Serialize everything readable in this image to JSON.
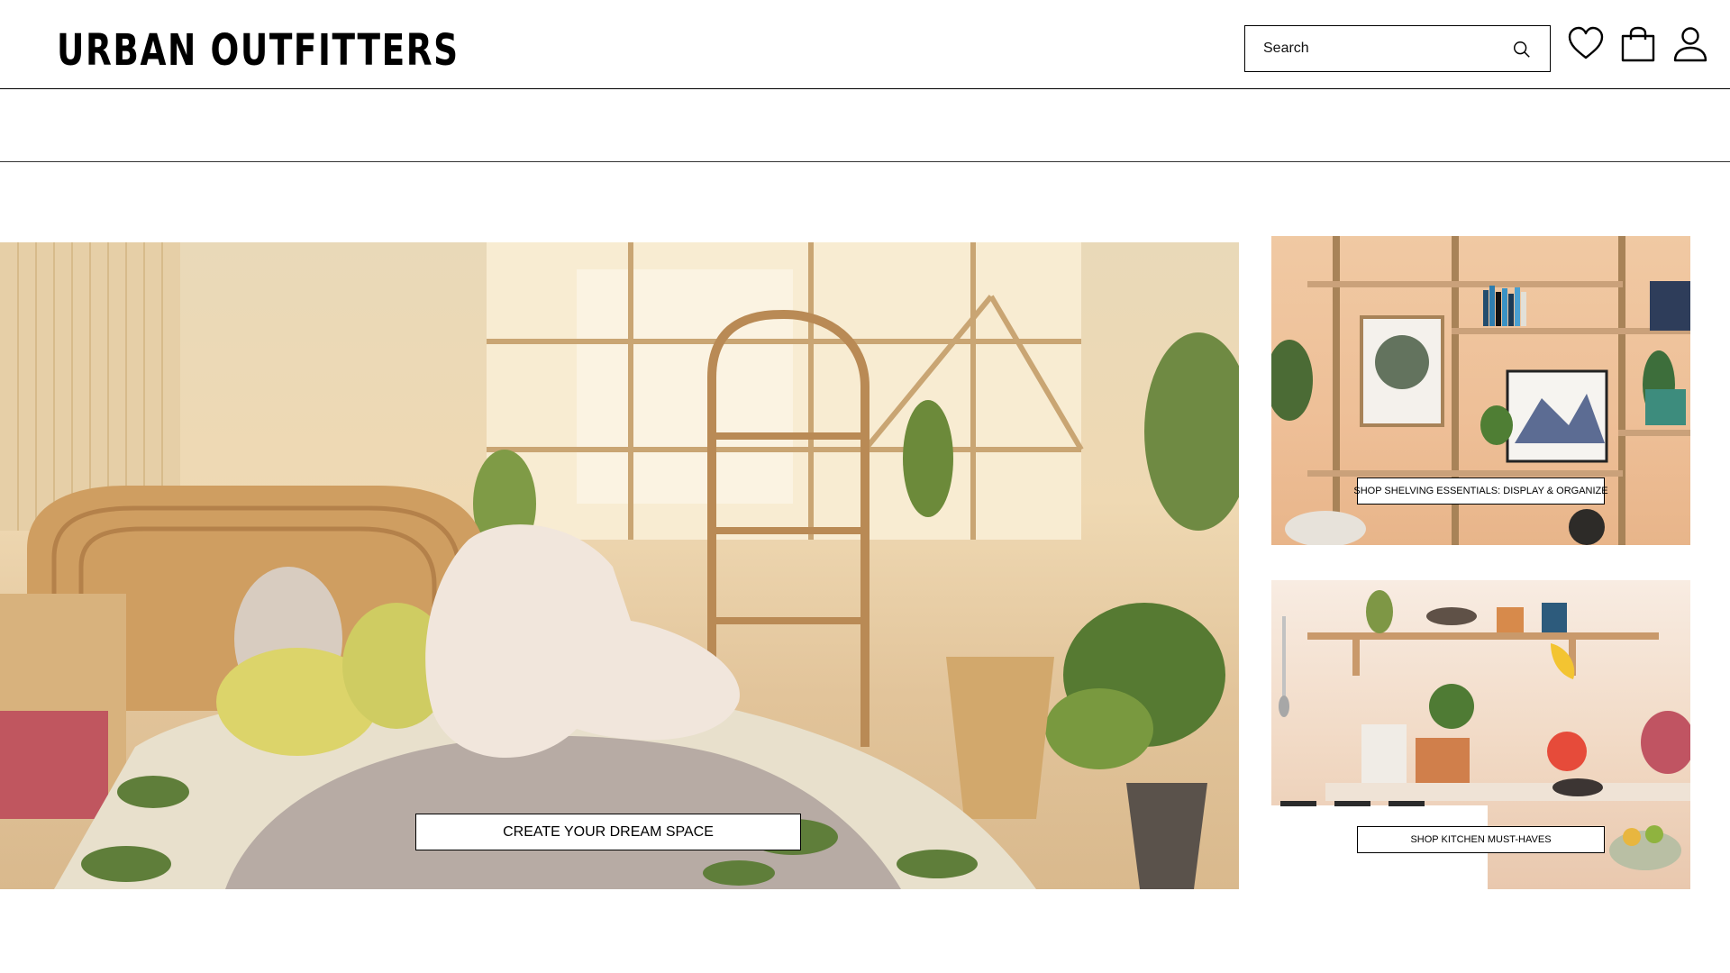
{
  "header": {
    "logo_text": "URBAN OUTFITTERS",
    "search": {
      "placeholder": "Search"
    },
    "icons": [
      "search-icon",
      "heart-icon",
      "bag-icon",
      "user-icon"
    ]
  },
  "hero": {
    "cta_label": "CREATE YOUR DREAM SPACE"
  },
  "promos": [
    {
      "cta_label": "SHOP SHELVING ESSENTIALS: DISPLAY & ORGANIZE"
    },
    {
      "cta_label": "SHOP KITCHEN MUST-HAVES"
    }
  ],
  "colors": {
    "text": "#000000",
    "background": "#ffffff",
    "border": "#000000"
  }
}
